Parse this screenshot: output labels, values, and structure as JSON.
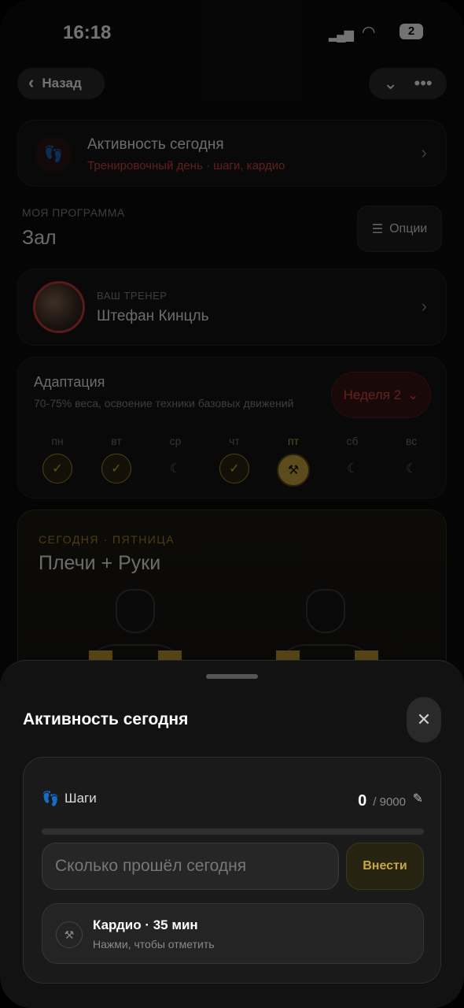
{
  "status_bar": {
    "time": "16:18",
    "battery": "2"
  },
  "nav": {
    "back_label": "Назад",
    "collapse_icon": "chevron-down",
    "more_icon": "ellipsis"
  },
  "activity": {
    "title": "Активность сегодня",
    "subtitle": "Тренировочный день · шаги, кардио"
  },
  "program": {
    "label": "МОЯ ПРОГРАММА",
    "name": "Зал",
    "options_label": "Опции"
  },
  "trainer": {
    "label": "ВАШ ТРЕНЕР",
    "name": "Штефан Кинцль"
  },
  "phase": {
    "title": "Адаптация",
    "description": "70-75% веса, освоение техники базовых движений",
    "week_label": "Неделя 2",
    "days": [
      {
        "label": "пн",
        "state": "done"
      },
      {
        "label": "вт",
        "state": "done"
      },
      {
        "label": "ср",
        "state": "rest"
      },
      {
        "label": "чт",
        "state": "done"
      },
      {
        "label": "пт",
        "state": "today"
      },
      {
        "label": "сб",
        "state": "rest"
      },
      {
        "label": "вс",
        "state": "rest"
      }
    ]
  },
  "today": {
    "label": "СЕГОДНЯ · ПЯТНИЦА",
    "title": "Плечи + Руки"
  },
  "sheet": {
    "title": "Активность сегодня",
    "steps": {
      "label": "Шаги",
      "value": "0",
      "goal": "/ 9000",
      "progress": 0,
      "input_placeholder": "Сколько прошёл сегодня",
      "submit_label": "Внести"
    },
    "cardio": {
      "title": "Кардио · 35 мин",
      "subtitle": "Нажми, чтобы отметить"
    }
  },
  "colors": {
    "accent_gold": "#c9a740",
    "accent_red": "#d8433e",
    "background": "#0d0d0d"
  }
}
